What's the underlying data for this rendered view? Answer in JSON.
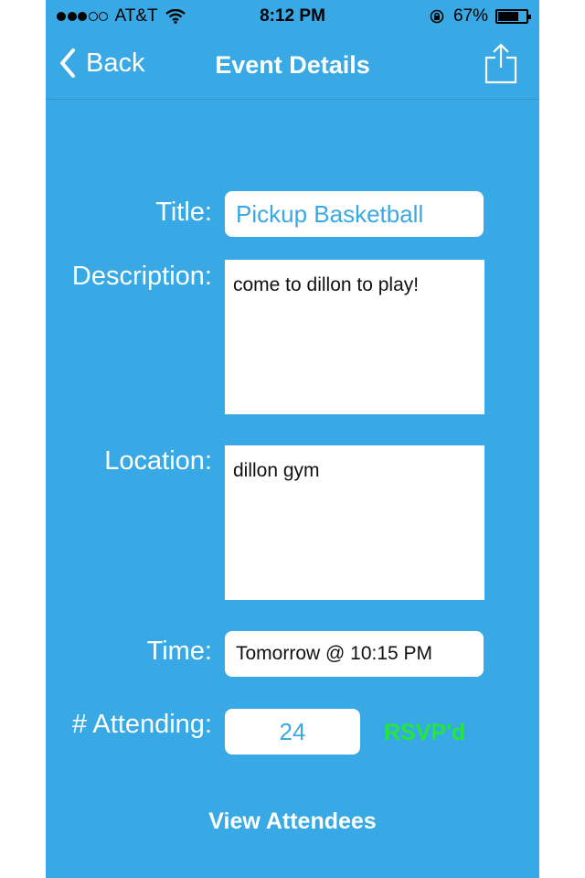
{
  "status_bar": {
    "carrier": "AT&T",
    "time": "8:12 PM",
    "battery_text": "67%",
    "battery_level": 0.67,
    "signal_bars_filled": 3,
    "signal_bars_total": 5
  },
  "nav": {
    "back_label": "Back",
    "title": "Event Details",
    "share_icon": "share-icon"
  },
  "form": {
    "title_label": "Title:",
    "title_value": "Pickup Basketball",
    "description_label": "Description:",
    "description_value": "come to dillon to play!",
    "location_label": "Location:",
    "location_value": "dillon gym",
    "time_label": "Time:",
    "time_value": "Tomorrow @ 10:15 PM",
    "attending_label": "# Attending:",
    "attending_value": "24",
    "rsvp_label": "RSVP'd"
  },
  "actions": {
    "view_attendees": "View Attendees"
  },
  "colors": {
    "background": "#38a9e4",
    "rsvp": "#22e83a",
    "field_text": "#38a9e4"
  }
}
